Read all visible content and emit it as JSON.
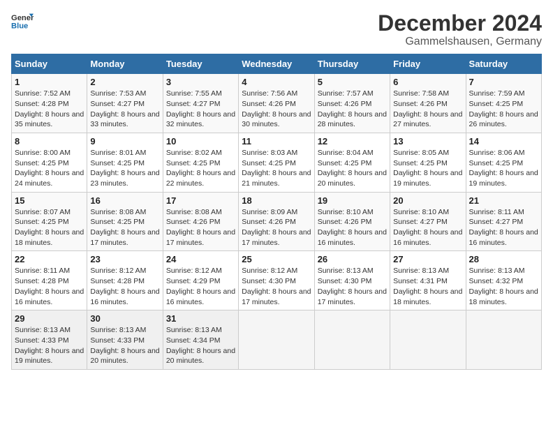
{
  "logo": {
    "text_general": "General",
    "text_blue": "Blue"
  },
  "title": "December 2024",
  "subtitle": "Gammelshausen, Germany",
  "headers": [
    "Sunday",
    "Monday",
    "Tuesday",
    "Wednesday",
    "Thursday",
    "Friday",
    "Saturday"
  ],
  "weeks": [
    [
      {
        "day": "1",
        "sunrise": "Sunrise: 7:52 AM",
        "sunset": "Sunset: 4:28 PM",
        "daylight": "Daylight: 8 hours and 35 minutes."
      },
      {
        "day": "2",
        "sunrise": "Sunrise: 7:53 AM",
        "sunset": "Sunset: 4:27 PM",
        "daylight": "Daylight: 8 hours and 33 minutes."
      },
      {
        "day": "3",
        "sunrise": "Sunrise: 7:55 AM",
        "sunset": "Sunset: 4:27 PM",
        "daylight": "Daylight: 8 hours and 32 minutes."
      },
      {
        "day": "4",
        "sunrise": "Sunrise: 7:56 AM",
        "sunset": "Sunset: 4:26 PM",
        "daylight": "Daylight: 8 hours and 30 minutes."
      },
      {
        "day": "5",
        "sunrise": "Sunrise: 7:57 AM",
        "sunset": "Sunset: 4:26 PM",
        "daylight": "Daylight: 8 hours and 28 minutes."
      },
      {
        "day": "6",
        "sunrise": "Sunrise: 7:58 AM",
        "sunset": "Sunset: 4:26 PM",
        "daylight": "Daylight: 8 hours and 27 minutes."
      },
      {
        "day": "7",
        "sunrise": "Sunrise: 7:59 AM",
        "sunset": "Sunset: 4:25 PM",
        "daylight": "Daylight: 8 hours and 26 minutes."
      }
    ],
    [
      {
        "day": "8",
        "sunrise": "Sunrise: 8:00 AM",
        "sunset": "Sunset: 4:25 PM",
        "daylight": "Daylight: 8 hours and 24 minutes."
      },
      {
        "day": "9",
        "sunrise": "Sunrise: 8:01 AM",
        "sunset": "Sunset: 4:25 PM",
        "daylight": "Daylight: 8 hours and 23 minutes."
      },
      {
        "day": "10",
        "sunrise": "Sunrise: 8:02 AM",
        "sunset": "Sunset: 4:25 PM",
        "daylight": "Daylight: 8 hours and 22 minutes."
      },
      {
        "day": "11",
        "sunrise": "Sunrise: 8:03 AM",
        "sunset": "Sunset: 4:25 PM",
        "daylight": "Daylight: 8 hours and 21 minutes."
      },
      {
        "day": "12",
        "sunrise": "Sunrise: 8:04 AM",
        "sunset": "Sunset: 4:25 PM",
        "daylight": "Daylight: 8 hours and 20 minutes."
      },
      {
        "day": "13",
        "sunrise": "Sunrise: 8:05 AM",
        "sunset": "Sunset: 4:25 PM",
        "daylight": "Daylight: 8 hours and 19 minutes."
      },
      {
        "day": "14",
        "sunrise": "Sunrise: 8:06 AM",
        "sunset": "Sunset: 4:25 PM",
        "daylight": "Daylight: 8 hours and 19 minutes."
      }
    ],
    [
      {
        "day": "15",
        "sunrise": "Sunrise: 8:07 AM",
        "sunset": "Sunset: 4:25 PM",
        "daylight": "Daylight: 8 hours and 18 minutes."
      },
      {
        "day": "16",
        "sunrise": "Sunrise: 8:08 AM",
        "sunset": "Sunset: 4:25 PM",
        "daylight": "Daylight: 8 hours and 17 minutes."
      },
      {
        "day": "17",
        "sunrise": "Sunrise: 8:08 AM",
        "sunset": "Sunset: 4:26 PM",
        "daylight": "Daylight: 8 hours and 17 minutes."
      },
      {
        "day": "18",
        "sunrise": "Sunrise: 8:09 AM",
        "sunset": "Sunset: 4:26 PM",
        "daylight": "Daylight: 8 hours and 17 minutes."
      },
      {
        "day": "19",
        "sunrise": "Sunrise: 8:10 AM",
        "sunset": "Sunset: 4:26 PM",
        "daylight": "Daylight: 8 hours and 16 minutes."
      },
      {
        "day": "20",
        "sunrise": "Sunrise: 8:10 AM",
        "sunset": "Sunset: 4:27 PM",
        "daylight": "Daylight: 8 hours and 16 minutes."
      },
      {
        "day": "21",
        "sunrise": "Sunrise: 8:11 AM",
        "sunset": "Sunset: 4:27 PM",
        "daylight": "Daylight: 8 hours and 16 minutes."
      }
    ],
    [
      {
        "day": "22",
        "sunrise": "Sunrise: 8:11 AM",
        "sunset": "Sunset: 4:28 PM",
        "daylight": "Daylight: 8 hours and 16 minutes."
      },
      {
        "day": "23",
        "sunrise": "Sunrise: 8:12 AM",
        "sunset": "Sunset: 4:28 PM",
        "daylight": "Daylight: 8 hours and 16 minutes."
      },
      {
        "day": "24",
        "sunrise": "Sunrise: 8:12 AM",
        "sunset": "Sunset: 4:29 PM",
        "daylight": "Daylight: 8 hours and 16 minutes."
      },
      {
        "day": "25",
        "sunrise": "Sunrise: 8:12 AM",
        "sunset": "Sunset: 4:30 PM",
        "daylight": "Daylight: 8 hours and 17 minutes."
      },
      {
        "day": "26",
        "sunrise": "Sunrise: 8:13 AM",
        "sunset": "Sunset: 4:30 PM",
        "daylight": "Daylight: 8 hours and 17 minutes."
      },
      {
        "day": "27",
        "sunrise": "Sunrise: 8:13 AM",
        "sunset": "Sunset: 4:31 PM",
        "daylight": "Daylight: 8 hours and 18 minutes."
      },
      {
        "day": "28",
        "sunrise": "Sunrise: 8:13 AM",
        "sunset": "Sunset: 4:32 PM",
        "daylight": "Daylight: 8 hours and 18 minutes."
      }
    ],
    [
      {
        "day": "29",
        "sunrise": "Sunrise: 8:13 AM",
        "sunset": "Sunset: 4:33 PM",
        "daylight": "Daylight: 8 hours and 19 minutes."
      },
      {
        "day": "30",
        "sunrise": "Sunrise: 8:13 AM",
        "sunset": "Sunset: 4:33 PM",
        "daylight": "Daylight: 8 hours and 20 minutes."
      },
      {
        "day": "31",
        "sunrise": "Sunrise: 8:13 AM",
        "sunset": "Sunset: 4:34 PM",
        "daylight": "Daylight: 8 hours and 20 minutes."
      },
      null,
      null,
      null,
      null
    ]
  ]
}
